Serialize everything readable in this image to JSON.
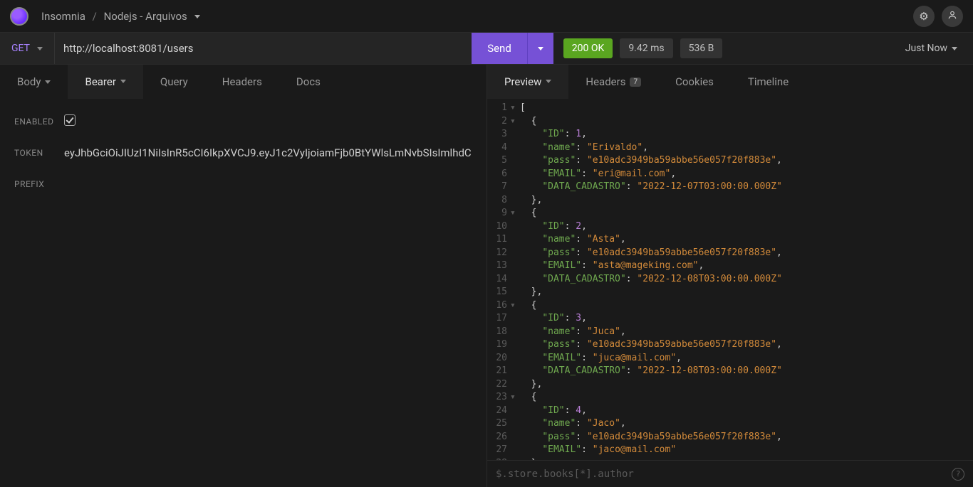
{
  "breadcrumb": {
    "app": "Insomnia",
    "workspace": "Nodejs - Arquivos"
  },
  "request": {
    "method": "GET",
    "url": "http://localhost:8081/users",
    "send_label": "Send"
  },
  "response_meta": {
    "status_code": "200",
    "status_text": "OK",
    "time": "9.42 ms",
    "size": "536 B",
    "when": "Just Now"
  },
  "req_tabs": {
    "body": "Body",
    "bearer": "Bearer",
    "query": "Query",
    "headers": "Headers",
    "docs": "Docs"
  },
  "auth": {
    "enabled_label": "ENABLED",
    "token_label": "TOKEN",
    "token_value": "eyJhbGciOiJIUzI1NiIsInR5cCI6IkpXVCJ9.eyJ1c2VyIjoiamFjb0BtYWlsLmNvbSIsImlhdC",
    "prefix_label": "PREFIX"
  },
  "resp_tabs": {
    "preview": "Preview",
    "headers": "Headers",
    "headers_count": "7",
    "cookies": "Cookies",
    "timeline": "Timeline"
  },
  "filter_placeholder": "$.store.books[*].author",
  "response_body": [
    {
      "ID": 1,
      "name": "Erivaldo",
      "pass": "e10adc3949ba59abbe56e057f20f883e",
      "EMAIL": "eri@mail.com",
      "DATA_CADASTRO": "2022-12-07T03:00:00.000Z"
    },
    {
      "ID": 2,
      "name": "Asta",
      "pass": "e10adc3949ba59abbe56e057f20f883e",
      "EMAIL": "asta@mageking.com",
      "DATA_CADASTRO": "2022-12-08T03:00:00.000Z"
    },
    {
      "ID": 3,
      "name": "Juca",
      "pass": "e10adc3949ba59abbe56e057f20f883e",
      "EMAIL": "juca@mail.com",
      "DATA_CADASTRO": "2022-12-08T03:00:00.000Z"
    },
    {
      "ID": 4,
      "name": "Jaco",
      "pass": "e10adc3949ba59abbe56e057f20f883e",
      "EMAIL": "jaco@mail.com"
    }
  ]
}
